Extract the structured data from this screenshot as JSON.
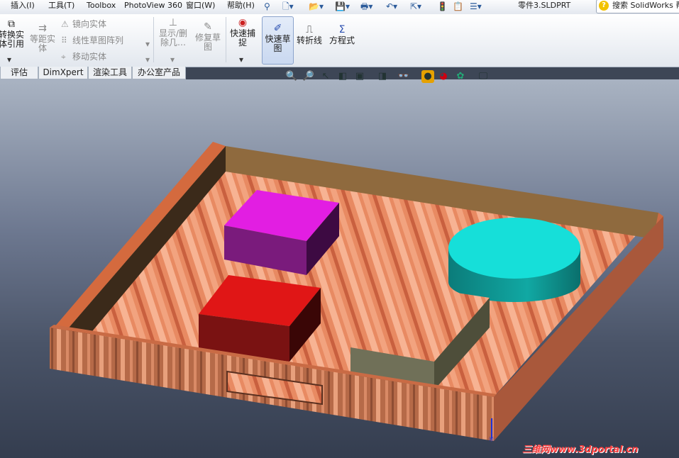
{
  "menubar": {
    "items": [
      "插入(I)",
      "工具(T)",
      "Toolbox",
      "PhotoView 360",
      "窗口(W)",
      "帮助(H)"
    ],
    "document_title": "零件3.SLDPRT",
    "search_placeholder": "搜索 SolidWorks 帮"
  },
  "ribbon": {
    "convert_entities": "转换实\n体引用",
    "offset_entities": "等距实\n体",
    "mirror_entities": "镜向实体",
    "linear_pattern": "线性草图阵列",
    "move_entities": "移动实体",
    "show_delete": "显示/删\n除几…",
    "repair_sketch": "修复草\n图",
    "quick_snaps": "快速捕\n捉",
    "rapid_sketch": "快速草\n图",
    "jog_line": "转折线",
    "equations": "方程式"
  },
  "tabs": [
    "评估",
    "DimXpert",
    "渲染工具",
    "办公室产品"
  ],
  "watermark": "三维网www.3dportal.cn",
  "colors": {
    "tray_wood": "#e07a55",
    "purple_box": "#8a1f8a",
    "red_box": "#d81414",
    "cyan_cylinder": "#18c9c4",
    "gray_box_side": "#6f6f58"
  }
}
